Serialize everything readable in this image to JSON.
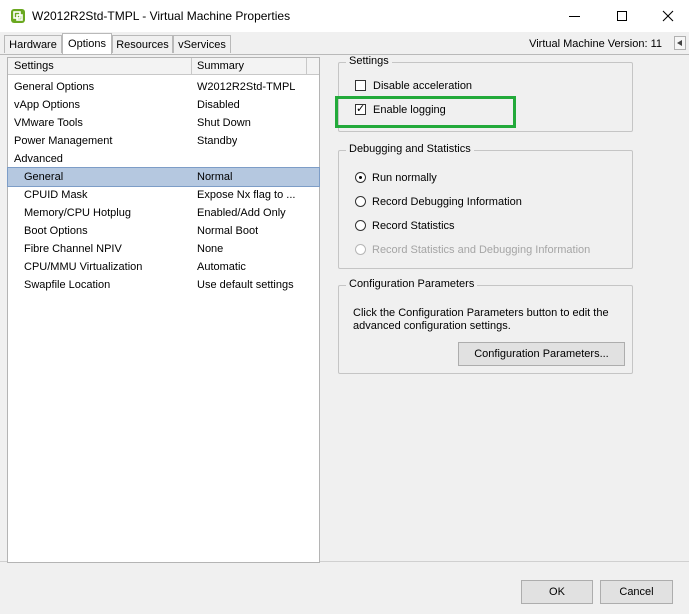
{
  "window": {
    "title": "W2012R2Std-TMPL - Virtual Machine Properties",
    "icon": "vm-properties-icon",
    "controls": [
      "minimize-icon",
      "maximize-icon",
      "close-icon"
    ]
  },
  "tabs": [
    {
      "label": "Hardware",
      "active": false
    },
    {
      "label": "Options",
      "active": true
    },
    {
      "label": "Resources",
      "active": false
    },
    {
      "label": "vServices",
      "active": false
    }
  ],
  "vm_version": "Virtual Machine Version: 11",
  "list": {
    "headers": [
      "Settings",
      "Summary"
    ],
    "rows": [
      {
        "setting": "General Options",
        "summary": "W2012R2Std-TMPL",
        "indent": false,
        "selected": false
      },
      {
        "setting": "vApp Options",
        "summary": "Disabled",
        "indent": false,
        "selected": false
      },
      {
        "setting": "VMware Tools",
        "summary": "Shut Down",
        "indent": false,
        "selected": false
      },
      {
        "setting": "Power Management",
        "summary": "Standby",
        "indent": false,
        "selected": false
      },
      {
        "setting": "Advanced",
        "summary": "",
        "indent": false,
        "selected": false
      },
      {
        "setting": "General",
        "summary": "Normal",
        "indent": true,
        "selected": true
      },
      {
        "setting": "CPUID Mask",
        "summary": "Expose Nx flag to ...",
        "indent": true,
        "selected": false
      },
      {
        "setting": "Memory/CPU Hotplug",
        "summary": "Enabled/Add Only",
        "indent": true,
        "selected": false
      },
      {
        "setting": "Boot Options",
        "summary": "Normal Boot",
        "indent": true,
        "selected": false
      },
      {
        "setting": "Fibre Channel NPIV",
        "summary": "None",
        "indent": true,
        "selected": false
      },
      {
        "setting": "CPU/MMU Virtualization",
        "summary": "Automatic",
        "indent": true,
        "selected": false
      },
      {
        "setting": "Swapfile Location",
        "summary": "Use default settings",
        "indent": true,
        "selected": false
      }
    ]
  },
  "settings_group": {
    "title": "Settings",
    "disable_acceleration": {
      "label": "Disable acceleration",
      "checked": false
    },
    "enable_logging": {
      "label": "Enable logging",
      "checked": true
    }
  },
  "debug_group": {
    "title": "Debugging and Statistics",
    "options": [
      {
        "label": "Run normally",
        "selected": true,
        "enabled": true
      },
      {
        "label": "Record Debugging Information",
        "selected": false,
        "enabled": true
      },
      {
        "label": "Record Statistics",
        "selected": false,
        "enabled": true
      },
      {
        "label": "Record Statistics and Debugging Information",
        "selected": false,
        "enabled": false
      }
    ]
  },
  "config_group": {
    "title": "Configuration Parameters",
    "description": "Click the Configuration Parameters button to edit the advanced configuration settings.",
    "button_label": "Configuration Parameters..."
  },
  "footer": {
    "ok_label": "OK",
    "cancel_label": "Cancel"
  },
  "colors": {
    "highlight_box": "#22aa3a",
    "selected_row": "#b5c8e0"
  }
}
